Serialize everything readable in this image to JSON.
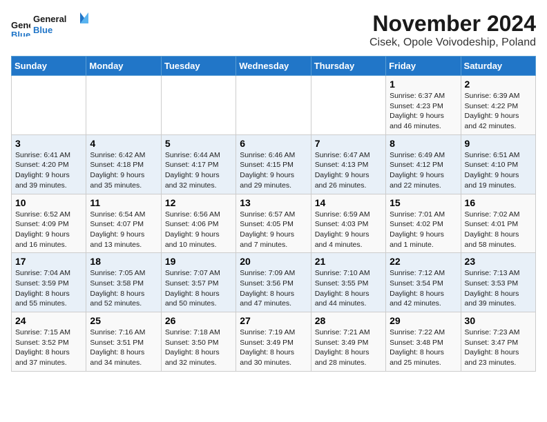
{
  "logo": {
    "general": "General",
    "blue": "Blue"
  },
  "header": {
    "month": "November 2024",
    "location": "Cisek, Opole Voivodeship, Poland"
  },
  "weekdays": [
    "Sunday",
    "Monday",
    "Tuesday",
    "Wednesday",
    "Thursday",
    "Friday",
    "Saturday"
  ],
  "weeks": [
    [
      {
        "day": "",
        "info": ""
      },
      {
        "day": "",
        "info": ""
      },
      {
        "day": "",
        "info": ""
      },
      {
        "day": "",
        "info": ""
      },
      {
        "day": "",
        "info": ""
      },
      {
        "day": "1",
        "info": "Sunrise: 6:37 AM\nSunset: 4:23 PM\nDaylight: 9 hours\nand 46 minutes."
      },
      {
        "day": "2",
        "info": "Sunrise: 6:39 AM\nSunset: 4:22 PM\nDaylight: 9 hours\nand 42 minutes."
      }
    ],
    [
      {
        "day": "3",
        "info": "Sunrise: 6:41 AM\nSunset: 4:20 PM\nDaylight: 9 hours\nand 39 minutes."
      },
      {
        "day": "4",
        "info": "Sunrise: 6:42 AM\nSunset: 4:18 PM\nDaylight: 9 hours\nand 35 minutes."
      },
      {
        "day": "5",
        "info": "Sunrise: 6:44 AM\nSunset: 4:17 PM\nDaylight: 9 hours\nand 32 minutes."
      },
      {
        "day": "6",
        "info": "Sunrise: 6:46 AM\nSunset: 4:15 PM\nDaylight: 9 hours\nand 29 minutes."
      },
      {
        "day": "7",
        "info": "Sunrise: 6:47 AM\nSunset: 4:13 PM\nDaylight: 9 hours\nand 26 minutes."
      },
      {
        "day": "8",
        "info": "Sunrise: 6:49 AM\nSunset: 4:12 PM\nDaylight: 9 hours\nand 22 minutes."
      },
      {
        "day": "9",
        "info": "Sunrise: 6:51 AM\nSunset: 4:10 PM\nDaylight: 9 hours\nand 19 minutes."
      }
    ],
    [
      {
        "day": "10",
        "info": "Sunrise: 6:52 AM\nSunset: 4:09 PM\nDaylight: 9 hours\nand 16 minutes."
      },
      {
        "day": "11",
        "info": "Sunrise: 6:54 AM\nSunset: 4:07 PM\nDaylight: 9 hours\nand 13 minutes."
      },
      {
        "day": "12",
        "info": "Sunrise: 6:56 AM\nSunset: 4:06 PM\nDaylight: 9 hours\nand 10 minutes."
      },
      {
        "day": "13",
        "info": "Sunrise: 6:57 AM\nSunset: 4:05 PM\nDaylight: 9 hours\nand 7 minutes."
      },
      {
        "day": "14",
        "info": "Sunrise: 6:59 AM\nSunset: 4:03 PM\nDaylight: 9 hours\nand 4 minutes."
      },
      {
        "day": "15",
        "info": "Sunrise: 7:01 AM\nSunset: 4:02 PM\nDaylight: 9 hours\nand 1 minute."
      },
      {
        "day": "16",
        "info": "Sunrise: 7:02 AM\nSunset: 4:01 PM\nDaylight: 8 hours\nand 58 minutes."
      }
    ],
    [
      {
        "day": "17",
        "info": "Sunrise: 7:04 AM\nSunset: 3:59 PM\nDaylight: 8 hours\nand 55 minutes."
      },
      {
        "day": "18",
        "info": "Sunrise: 7:05 AM\nSunset: 3:58 PM\nDaylight: 8 hours\nand 52 minutes."
      },
      {
        "day": "19",
        "info": "Sunrise: 7:07 AM\nSunset: 3:57 PM\nDaylight: 8 hours\nand 50 minutes."
      },
      {
        "day": "20",
        "info": "Sunrise: 7:09 AM\nSunset: 3:56 PM\nDaylight: 8 hours\nand 47 minutes."
      },
      {
        "day": "21",
        "info": "Sunrise: 7:10 AM\nSunset: 3:55 PM\nDaylight: 8 hours\nand 44 minutes."
      },
      {
        "day": "22",
        "info": "Sunrise: 7:12 AM\nSunset: 3:54 PM\nDaylight: 8 hours\nand 42 minutes."
      },
      {
        "day": "23",
        "info": "Sunrise: 7:13 AM\nSunset: 3:53 PM\nDaylight: 8 hours\nand 39 minutes."
      }
    ],
    [
      {
        "day": "24",
        "info": "Sunrise: 7:15 AM\nSunset: 3:52 PM\nDaylight: 8 hours\nand 37 minutes."
      },
      {
        "day": "25",
        "info": "Sunrise: 7:16 AM\nSunset: 3:51 PM\nDaylight: 8 hours\nand 34 minutes."
      },
      {
        "day": "26",
        "info": "Sunrise: 7:18 AM\nSunset: 3:50 PM\nDaylight: 8 hours\nand 32 minutes."
      },
      {
        "day": "27",
        "info": "Sunrise: 7:19 AM\nSunset: 3:49 PM\nDaylight: 8 hours\nand 30 minutes."
      },
      {
        "day": "28",
        "info": "Sunrise: 7:21 AM\nSunset: 3:49 PM\nDaylight: 8 hours\nand 28 minutes."
      },
      {
        "day": "29",
        "info": "Sunrise: 7:22 AM\nSunset: 3:48 PM\nDaylight: 8 hours\nand 25 minutes."
      },
      {
        "day": "30",
        "info": "Sunrise: 7:23 AM\nSunset: 3:47 PM\nDaylight: 8 hours\nand 23 minutes."
      }
    ]
  ]
}
